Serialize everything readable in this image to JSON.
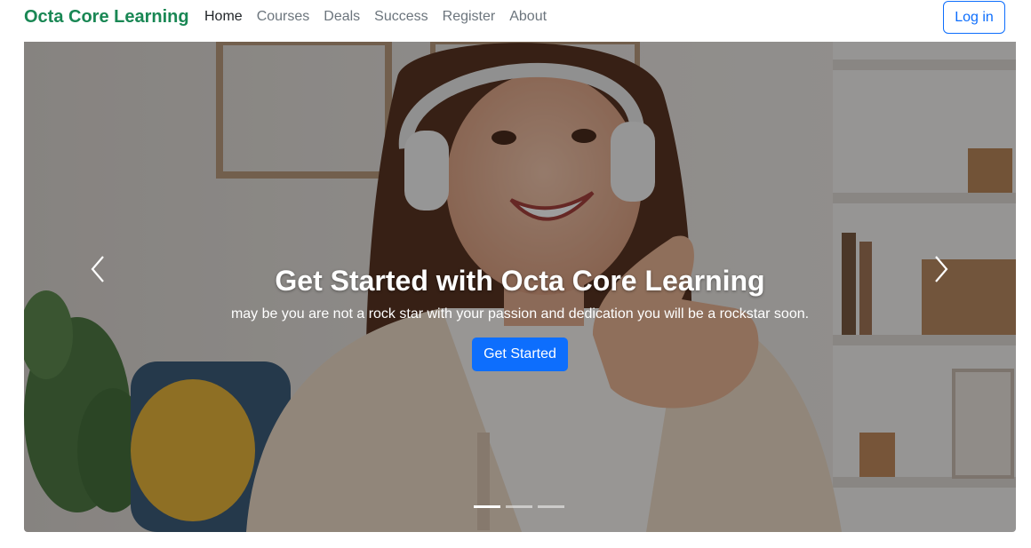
{
  "brand": {
    "name": "Octa Core Learning",
    "color": "#198754"
  },
  "nav": {
    "items": [
      {
        "label": "Home",
        "active": true
      },
      {
        "label": "Courses",
        "active": false
      },
      {
        "label": "Deals",
        "active": false
      },
      {
        "label": "Success",
        "active": false
      },
      {
        "label": "Register",
        "active": false
      },
      {
        "label": "About",
        "active": false
      }
    ],
    "login_label": "Log in"
  },
  "hero": {
    "title": "Get Started with Octa Core Learning",
    "subtitle": "may be you are not a rock star with your passion and dedication you will be a rockstar soon.",
    "cta_label": "Get Started",
    "prev_icon": "chevron-left-icon",
    "next_icon": "chevron-right-icon",
    "slide_count": 3,
    "active_slide": 1
  },
  "colors": {
    "primary": "#0d6efd",
    "nav_text": "#6c757d",
    "nav_active": "#212529"
  }
}
